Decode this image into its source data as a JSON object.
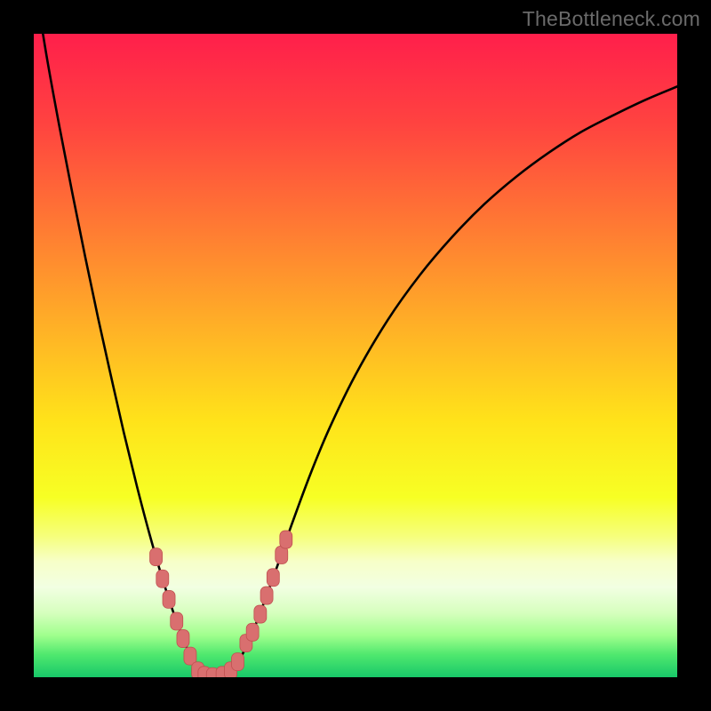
{
  "watermark": "TheBottleneck.com",
  "colors": {
    "frame": "#000000",
    "curve": "#000000",
    "marker_fill": "#d96f6f",
    "marker_stroke": "#c05050",
    "gradient_stops": [
      {
        "offset": 0.0,
        "color": "#ff1f4b"
      },
      {
        "offset": 0.14,
        "color": "#ff4340"
      },
      {
        "offset": 0.3,
        "color": "#ff7a33"
      },
      {
        "offset": 0.46,
        "color": "#ffb226"
      },
      {
        "offset": 0.6,
        "color": "#ffe21a"
      },
      {
        "offset": 0.72,
        "color": "#f7ff24"
      },
      {
        "offset": 0.78,
        "color": "#f6ff7a"
      },
      {
        "offset": 0.82,
        "color": "#f7ffc8"
      },
      {
        "offset": 0.86,
        "color": "#f2ffe2"
      },
      {
        "offset": 0.9,
        "color": "#d6ffbe"
      },
      {
        "offset": 0.935,
        "color": "#a0ff8d"
      },
      {
        "offset": 0.965,
        "color": "#4fe86e"
      },
      {
        "offset": 1.0,
        "color": "#18c869"
      }
    ]
  },
  "chart_data": {
    "type": "line",
    "title": "",
    "xlabel": "",
    "ylabel": "",
    "xlim": [
      0,
      1
    ],
    "ylim": [
      0,
      1
    ],
    "series": [
      {
        "name": "bottleneck-curve",
        "x": [
          0.0,
          0.02,
          0.04,
          0.06,
          0.08,
          0.1,
          0.12,
          0.14,
          0.16,
          0.18,
          0.2,
          0.22,
          0.235,
          0.25,
          0.262,
          0.275,
          0.288,
          0.3,
          0.32,
          0.34,
          0.36,
          0.38,
          0.4,
          0.43,
          0.46,
          0.5,
          0.55,
          0.6,
          0.65,
          0.7,
          0.75,
          0.8,
          0.85,
          0.9,
          0.95,
          1.0
        ],
        "y": [
          1.09,
          0.965,
          0.855,
          0.752,
          0.653,
          0.558,
          0.468,
          0.38,
          0.298,
          0.222,
          0.153,
          0.092,
          0.053,
          0.018,
          0.005,
          0.001,
          0.001,
          0.005,
          0.028,
          0.07,
          0.122,
          0.177,
          0.235,
          0.316,
          0.388,
          0.47,
          0.555,
          0.625,
          0.684,
          0.735,
          0.778,
          0.815,
          0.847,
          0.873,
          0.897,
          0.918
        ]
      }
    ],
    "markers": [
      {
        "x": 0.19,
        "y": 0.187
      },
      {
        "x": 0.2,
        "y": 0.153
      },
      {
        "x": 0.21,
        "y": 0.121
      },
      {
        "x": 0.222,
        "y": 0.087
      },
      {
        "x": 0.232,
        "y": 0.06
      },
      {
        "x": 0.243,
        "y": 0.033
      },
      {
        "x": 0.255,
        "y": 0.01
      },
      {
        "x": 0.265,
        "y": 0.003
      },
      {
        "x": 0.278,
        "y": 0.001
      },
      {
        "x": 0.293,
        "y": 0.003
      },
      {
        "x": 0.306,
        "y": 0.01
      },
      {
        "x": 0.317,
        "y": 0.024
      },
      {
        "x": 0.33,
        "y": 0.053
      },
      {
        "x": 0.34,
        "y": 0.07
      },
      {
        "x": 0.352,
        "y": 0.098
      },
      {
        "x": 0.362,
        "y": 0.127
      },
      {
        "x": 0.372,
        "y": 0.155
      },
      {
        "x": 0.385,
        "y": 0.19
      },
      {
        "x": 0.392,
        "y": 0.214
      }
    ]
  }
}
